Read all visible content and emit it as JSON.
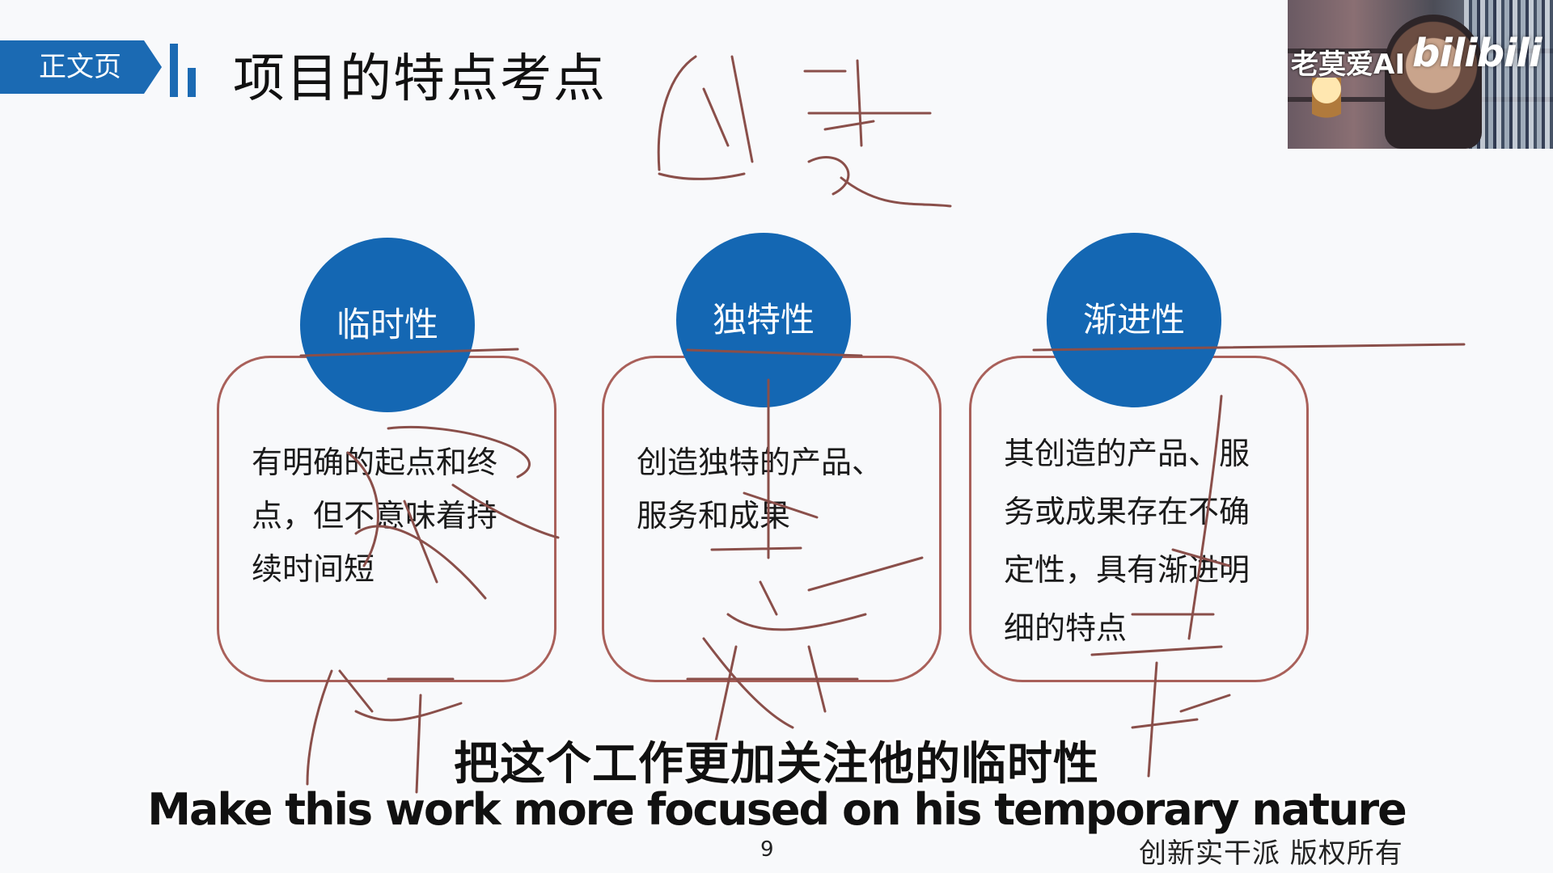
{
  "header": {
    "tag_label": "正文页",
    "title": "项目的特点考点"
  },
  "cards": [
    {
      "bubble_label": "临时性",
      "lines": [
        "有明确的起点和终",
        "点，但不意味着持",
        "续时间短"
      ]
    },
    {
      "bubble_label": "独特性",
      "lines": [
        "创造独特的产品、",
        "服务和成果"
      ]
    },
    {
      "bubble_label": "渐进性",
      "lines": [
        "其创造的产品、服",
        "务或成果存在不确",
        "定性，具有渐进明",
        "细的特点"
      ]
    }
  ],
  "webcam": {
    "overlay_text": "老莫爱AI",
    "logo_text": "bilibili"
  },
  "subtitles": {
    "chinese": "把这个工作更加关注他的临时性",
    "english": "Make this work more focused on his temporary nature"
  },
  "footer": {
    "page_number": "9",
    "copyright": "创新实干派  版权所有"
  },
  "colors": {
    "accent_blue": "#1467b3",
    "card_border": "#a9605a",
    "ink": "#8a4f4a"
  }
}
